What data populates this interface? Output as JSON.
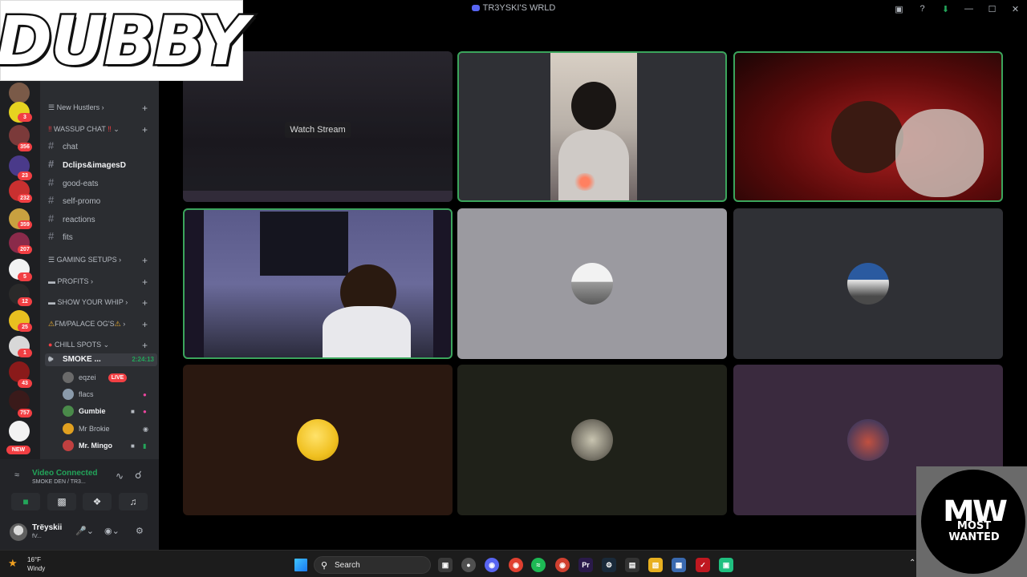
{
  "window": {
    "title": "TR3YSKI'S WRLD"
  },
  "overlays": {
    "logo_left": "DUBBY",
    "logo_right_mark": "MW",
    "logo_right_text": "MOST WANTED"
  },
  "servers": [
    {
      "badge": "3"
    },
    {
      "badge": "356"
    },
    {
      "badge": "23"
    },
    {
      "badge": "232"
    },
    {
      "badge": "359"
    },
    {
      "badge": "207"
    },
    {
      "badge": "5"
    },
    {
      "badge": "12"
    },
    {
      "badge": "25"
    },
    {
      "badge": "1"
    },
    {
      "badge": "43"
    },
    {
      "badge": "757"
    }
  ],
  "new_badge": "NEW",
  "sidebar": {
    "categories": {
      "new_hustlers": "New Hustlers",
      "wassup": "WASSUP CHAT",
      "gaming": "GAMING SETUPS",
      "profits": "PROFITS",
      "whip": "SHOW YOUR WHIP",
      "palace": "FM/PALACE OG'S",
      "chill": "CHILL SPOTS"
    },
    "channels": {
      "chat": "chat",
      "clips": "Dclips&imagesD",
      "eats": "good-eats",
      "promo": "self-promo",
      "reactions": "reactions",
      "fits": "fits"
    },
    "voice_channel": {
      "name": "SMOKE ...",
      "timer": "2:24:13"
    },
    "voice_users": [
      "eqzei",
      "flacs",
      "Gumbie",
      "Mr Brokie",
      "Mr. Mingo"
    ],
    "live_badge": "LIVE"
  },
  "voice_panel": {
    "status": "Video Connected",
    "location": "SMOKE DEN / TR3...",
    "user_name": "Trëyskii",
    "user_status": "fV..."
  },
  "grid": {
    "watch_stream": "Watch Stream"
  },
  "taskbar": {
    "temp": "16°F",
    "weather": "Windy",
    "search": "Search"
  },
  "colors": {
    "accent": "#5865f2",
    "speaking": "#3ba55c",
    "live": "#f23f43",
    "connected": "#23a55a"
  }
}
